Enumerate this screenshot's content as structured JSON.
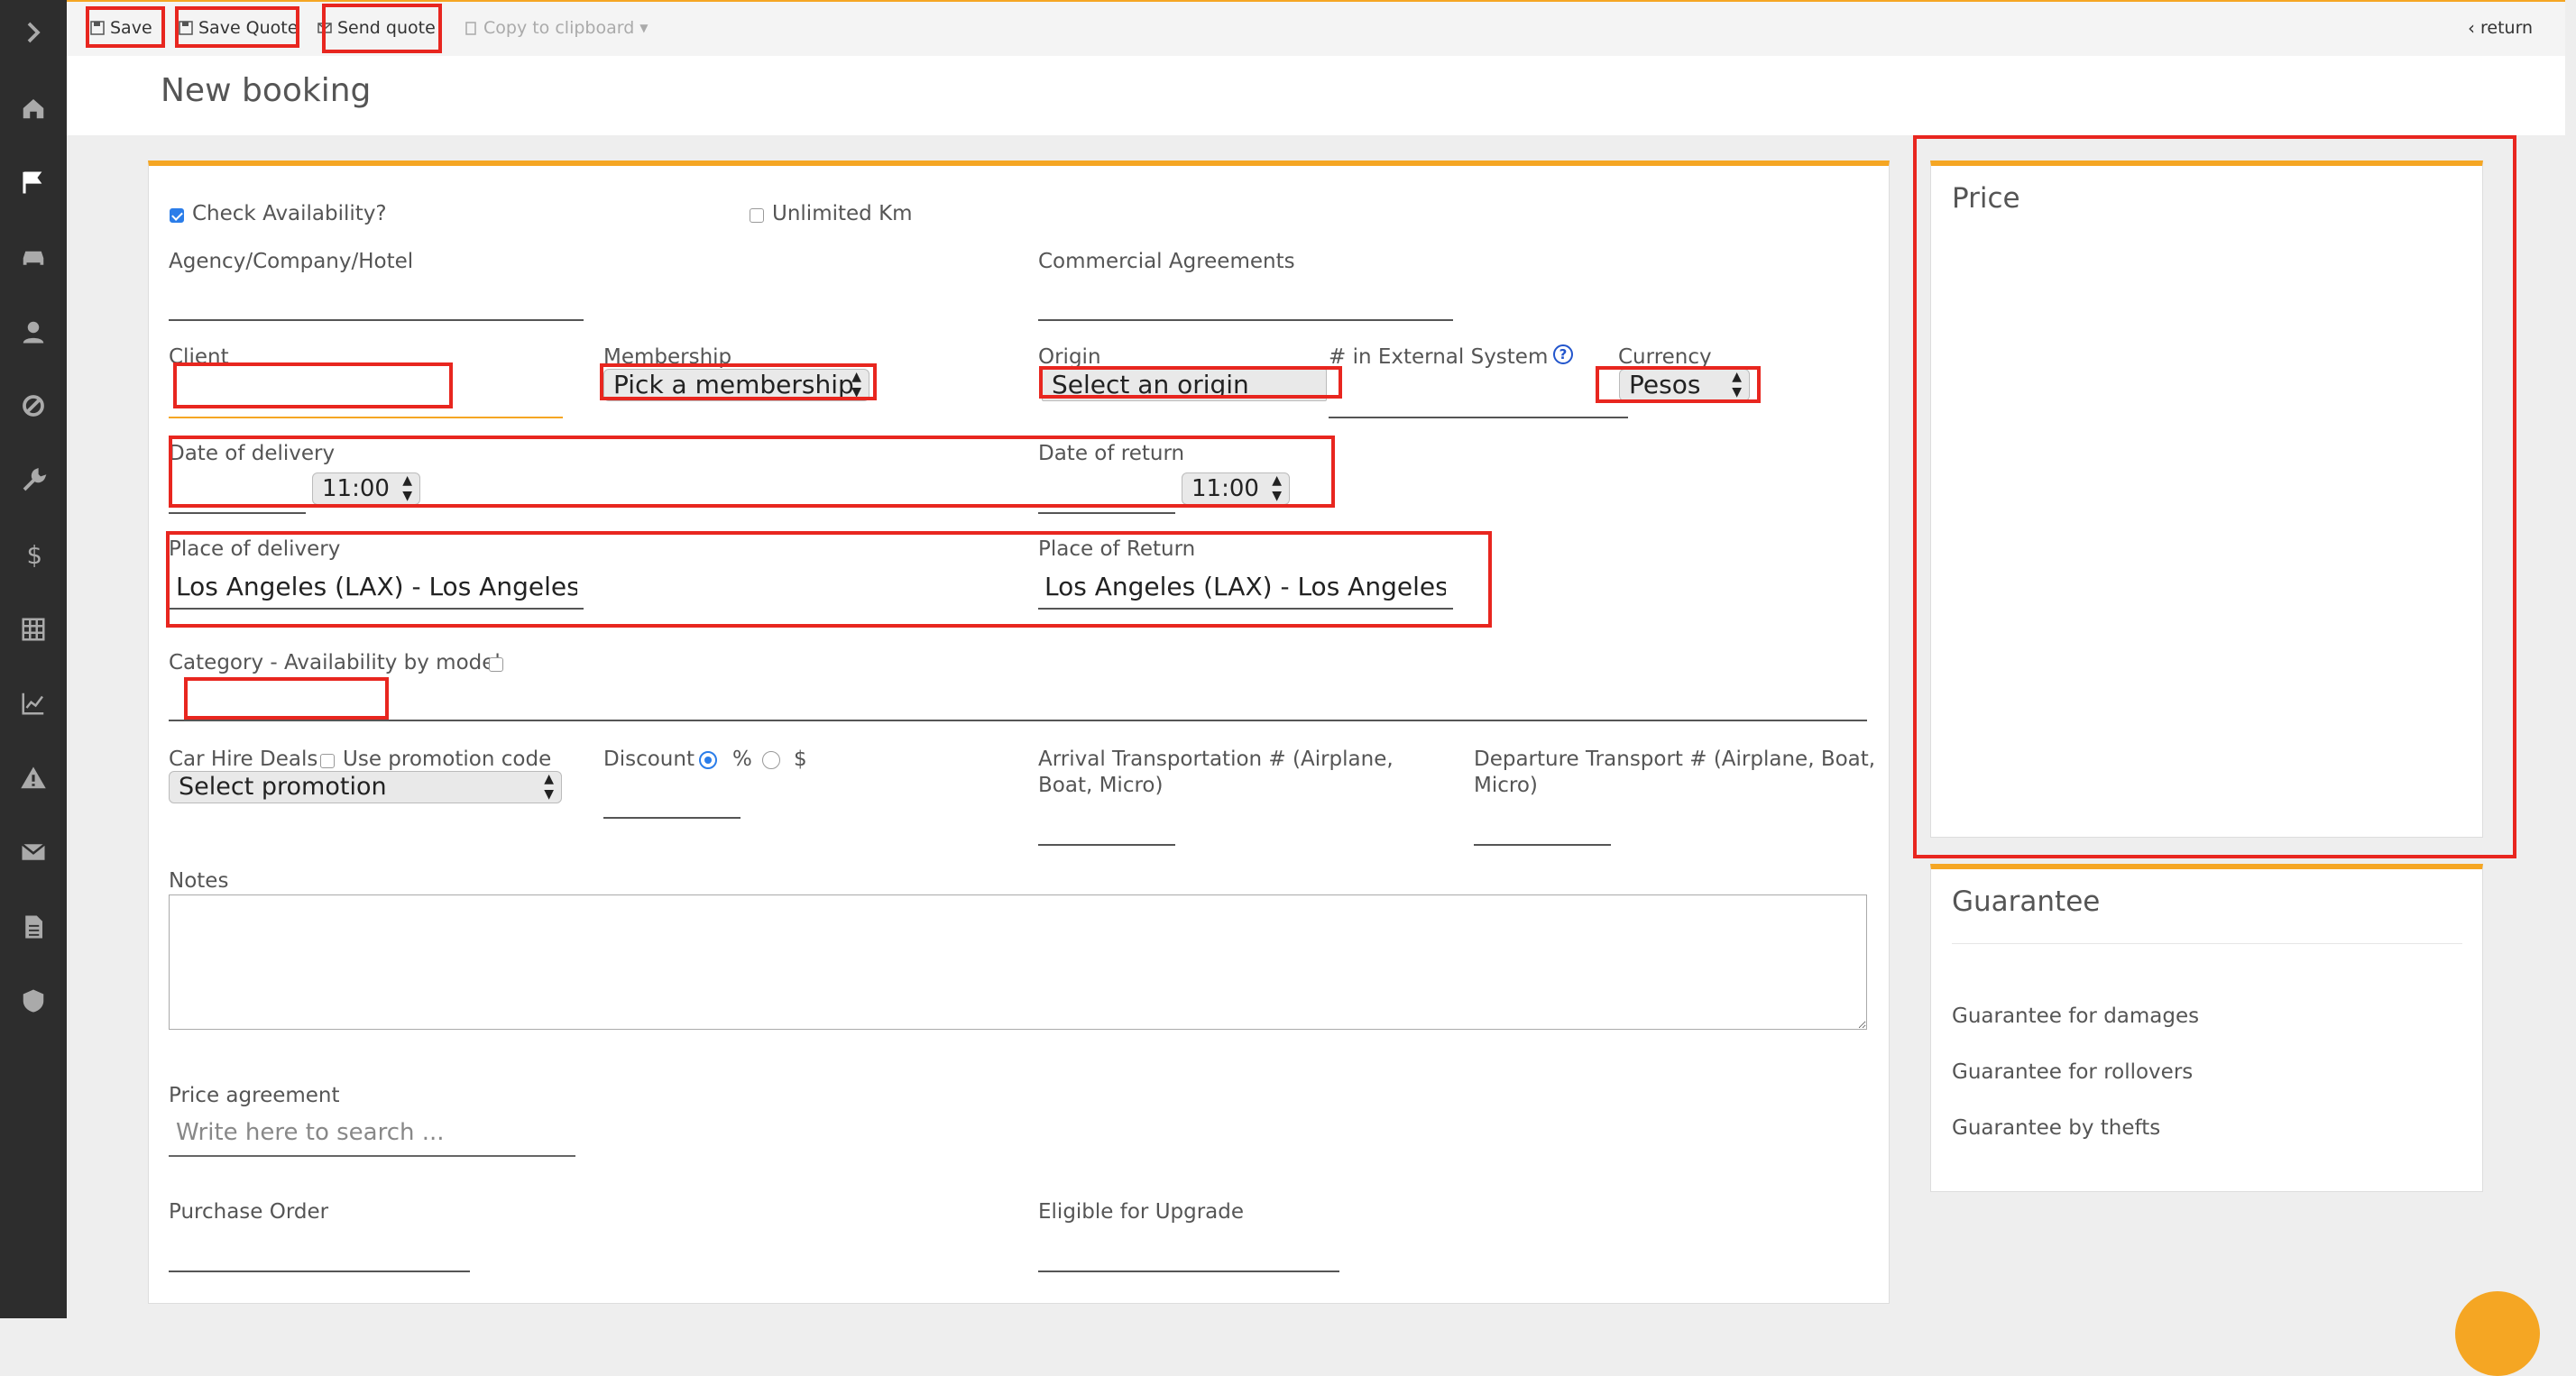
{
  "toolbar": {
    "save_label": "Save",
    "save_quote_label": "Save Quote",
    "send_quote_label": "Send quote",
    "copy_clipboard_label": "Copy to clipboard",
    "return_label": "return"
  },
  "page": {
    "title": "New booking"
  },
  "form": {
    "check_availability_label": "Check Availability?",
    "check_availability_checked": true,
    "unlimited_km_label": "Unlimited Km",
    "agency_label": "Agency/Company/Hotel",
    "commercial_agreements_label": "Commercial Agreements",
    "client_label": "Client",
    "membership_label": "Membership",
    "membership_value": "Pick a membership",
    "origin_label": "Origin",
    "origin_value": "Select an origin",
    "external_system_label": "# in External System",
    "help_icon_glyph": "?",
    "currency_label": "Currency",
    "currency_value": "Pesos",
    "date_delivery_label": "Date of delivery",
    "delivery_time": "11:00",
    "date_return_label": "Date of return",
    "return_time": "11:00",
    "place_delivery_label": "Place of delivery",
    "place_delivery_value": "Los Angeles (LAX)  - Los Angeles (",
    "place_return_label": "Place of Return",
    "place_return_value": "Los Angeles (LAX)  - Los Angeles (",
    "category_label": "Category - Availability by model",
    "car_hire_deals_label": "Car Hire Deals",
    "use_promotion_label": "Use promotion code",
    "promotion_value": "Select promotion",
    "discount_label": "Discount",
    "discount_percent": "%",
    "discount_dollar": "$",
    "arrival_label_line1": "Arrival Transportation # (Airplane,",
    "arrival_label_line2": "Boat, Micro)",
    "departure_label_line1": "Departure Transport # (Airplane, Boat,",
    "departure_label_line2": "Micro)",
    "notes_label": "Notes",
    "price_agreement_label": "Price agreement",
    "price_agreement_placeholder": "Write here to search ...",
    "purchase_order_label": "Purchase Order",
    "eligible_upgrade_label": "Eligible for Upgrade"
  },
  "price_panel": {
    "title": "Price"
  },
  "guarantee_panel": {
    "title": "Guarantee",
    "items": [
      "Guarantee for damages",
      "Guarantee for rollovers",
      "Guarantee by thefts"
    ]
  },
  "colors": {
    "accent": "#f5a623",
    "sidebar": "#2d2d2d",
    "highlight": "#e8261f",
    "check": "#2b7de9"
  },
  "sidebar_icons": [
    "chevron-right-icon",
    "home-icon",
    "flag-icon",
    "car-icon",
    "user-icon",
    "ban-icon",
    "wrench-icon",
    "dollar-icon",
    "calculator-icon",
    "chart-line-icon",
    "warning-icon",
    "envelope-icon",
    "document-icon",
    "shield-icon"
  ]
}
